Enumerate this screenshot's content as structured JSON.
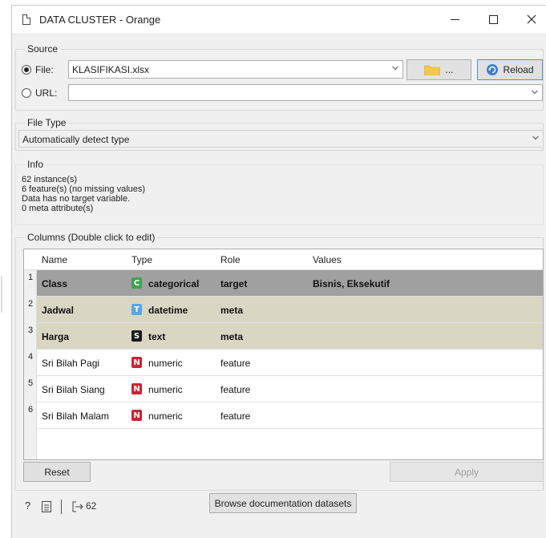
{
  "window": {
    "title": "DATA CLUSTER - Orange",
    "minimize": "—",
    "maximize": "☐",
    "close": "✕"
  },
  "source": {
    "group_title": "Source",
    "file_label": "File:",
    "file_value": "KLASIFIKASI.xlsx",
    "file_selected": true,
    "browse_label": "...",
    "reload_label": "Reload",
    "url_label": "URL:",
    "url_value": ""
  },
  "file_type": {
    "group_title": "File Type",
    "value": "Automatically detect type"
  },
  "info": {
    "group_title": "Info",
    "lines": [
      "62 instance(s)",
      "6 feature(s) (no missing values)",
      "Data has no target variable.",
      "0 meta attribute(s)"
    ]
  },
  "columns": {
    "group_title": "Columns (Double click to edit)",
    "headers": [
      "Name",
      "Type",
      "Role",
      "Values"
    ],
    "rows": [
      {
        "num": "1",
        "name": "Class",
        "badge": "C",
        "badge_color": "#3fa34d",
        "type": "categorical",
        "role": "target",
        "values": "Bisnis, Eksekutif",
        "bg": "#a0a0a0"
      },
      {
        "num": "2",
        "name": "Jadwal",
        "badge": "T",
        "badge_color": "#58a6e8",
        "type": "datetime",
        "role": "meta",
        "values": "",
        "bg": "#d9d6c3"
      },
      {
        "num": "3",
        "name": "Harga",
        "badge": "S",
        "badge_color": "#1a1a1a",
        "type": "text",
        "role": "meta",
        "values": "",
        "bg": "#d9d6c3"
      },
      {
        "num": "4",
        "name": "Sri Bilah Pagi",
        "badge": "N",
        "badge_color": "#cc2233",
        "type": "numeric",
        "role": "feature",
        "values": "",
        "bg": "#ffffff"
      },
      {
        "num": "5",
        "name": "Sri Bilah Siang",
        "badge": "N",
        "badge_color": "#cc2233",
        "type": "numeric",
        "role": "feature",
        "values": "",
        "bg": "#ffffff"
      },
      {
        "num": "6",
        "name": "Sri Bilah Malam",
        "badge": "N",
        "badge_color": "#cc2233",
        "type": "numeric",
        "role": "feature",
        "values": "",
        "bg": "#ffffff"
      }
    ]
  },
  "buttons": {
    "reset": "Reset",
    "apply": "Apply",
    "browse_docs": "Browse documentation datasets"
  },
  "status": {
    "help_icon": "?",
    "output_count": "62"
  },
  "colors": {
    "accent": "#4f90d9",
    "folder": "#f2c84b",
    "reload": "#3b7dd8"
  }
}
